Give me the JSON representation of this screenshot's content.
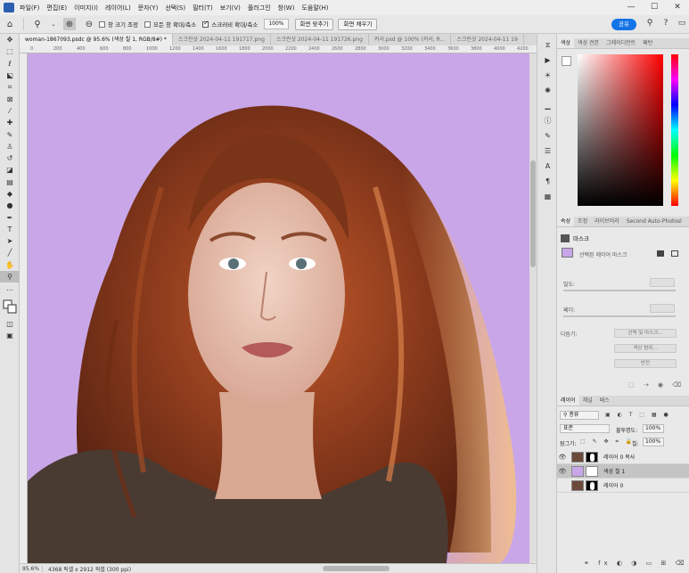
{
  "menu": {
    "items": [
      "파일(F)",
      "편집(E)",
      "이미지(I)",
      "레이어(L)",
      "문자(Y)",
      "선택(S)",
      "필터(T)",
      "보기(V)",
      "플러그인",
      "창(W)",
      "도움말(H)"
    ],
    "window_controls": [
      "—",
      "☐",
      "✕"
    ]
  },
  "options_bar": {
    "home_icon": "home-icon",
    "zoom_icon": "zoom-icon",
    "checkbox1": "창 크기 조정",
    "checkbox2": "모든 창 확대/축소",
    "checkbox3": "스크러비 확대/축소",
    "zoom_value": "100%",
    "fit_screen": "화면 맞추기",
    "fill_screen": "화면 채우기",
    "share": "공유"
  },
  "tabs": [
    "woman-1867093.psdc @ 95.6% (색상 칠 1, RGB/8#) *",
    "스크린샷 2024-04-11 191717.png",
    "스크린샷 2024-04-11 191726.png",
    "커서.psd @ 100% (커서, R...",
    "스크린샷 2024-04-11 19"
  ],
  "ruler_ticks": [
    "0",
    "200",
    "400",
    "600",
    "800",
    "1000",
    "1200",
    "1400",
    "1600",
    "1800",
    "2000",
    "2200",
    "2400",
    "2600",
    "2800",
    "3000",
    "3200",
    "3400",
    "3600",
    "3800",
    "4000",
    "4200"
  ],
  "status": {
    "zoom": "95.6%",
    "info": "4368 픽셀 x 2912 픽셀 (300 ppi)"
  },
  "color_panel": {
    "tabs": [
      "색상",
      "색상 견본",
      "그레이디언트",
      "패턴"
    ]
  },
  "properties_panel": {
    "tabs": [
      "속성",
      "조정",
      "라이브러리",
      "Second Auto-Photosl"
    ],
    "title": "마스크",
    "mask_label": "선택된 레이어 마스크",
    "density_label": "밀도:",
    "feather_label": "페더:",
    "refine_label": "다듬기:",
    "select_mask_btn": "선택 및 마스크...",
    "color_range_btn": "색상 범위...",
    "invert_btn": "반전"
  },
  "layers_panel": {
    "tabs": [
      "레이어",
      "채널",
      "패스"
    ],
    "filter_kind": "종류",
    "blend_mode": "표준",
    "opacity_label": "불투명도:",
    "opacity_value": "100%",
    "lock_label": "잠그기:",
    "fill_label": "칠:",
    "fill_value": "100%",
    "layers": [
      {
        "name": "레이어 0 복사",
        "visible": true,
        "type": "image-mask"
      },
      {
        "name": "색상 칠 1",
        "visible": true,
        "type": "fill",
        "selected": true
      },
      {
        "name": "레이어 0",
        "visible": false,
        "type": "image-mask"
      }
    ]
  },
  "colors": {
    "canvas_bg": "#c9a6e8",
    "accent": "#1473e6",
    "hair": "#8a3a1c"
  }
}
